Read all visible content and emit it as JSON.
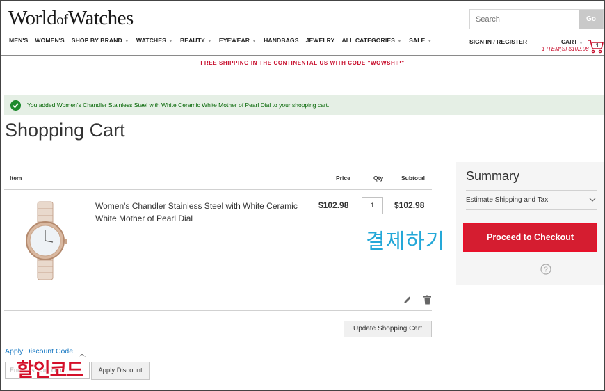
{
  "header": {
    "logo_world": "World",
    "logo_of": "of",
    "logo_watches": "Watches",
    "search_placeholder": "Search",
    "search_button": "Go",
    "nav": [
      {
        "label": "MEN'S",
        "dropdown": false
      },
      {
        "label": "WOMEN'S",
        "dropdown": false
      },
      {
        "label": "SHOP BY BRAND",
        "dropdown": true
      },
      {
        "label": "WATCHES",
        "dropdown": true
      },
      {
        "label": "BEAUTY",
        "dropdown": true
      },
      {
        "label": "EYEWEAR",
        "dropdown": true
      },
      {
        "label": "HANDBAGS",
        "dropdown": false
      },
      {
        "label": "JEWELRY",
        "dropdown": false
      },
      {
        "label": "ALL CATEGORIES",
        "dropdown": true
      },
      {
        "label": "SALE",
        "dropdown": true
      }
    ],
    "signin": "SIGN IN / REGISTER",
    "cart_label": "CART",
    "cart_summary": "1 ITEM(S) $102.98",
    "cart_count": "1"
  },
  "promo": "FREE SHIPPING IN THE CONTINENTAL US WITH CODE \"WOWSHIP\"",
  "success_message": "You added Women's Chandler Stainless Steel with White Ceramic White Mother of Pearl Dial to your shopping cart.",
  "page_title": "Shopping Cart",
  "table": {
    "col_item": "Item",
    "col_price": "Price",
    "col_qty": "Qty",
    "col_subtotal": "Subtotal"
  },
  "cart_item": {
    "name": "Women's Chandler Stainless Steel with White Ceramic White Mother of Pearl Dial",
    "price": "$102.98",
    "qty": "1",
    "subtotal": "$102.98"
  },
  "annotations": {
    "checkout_korean": "결제하기",
    "discount_korean": "할인코드"
  },
  "update_button": "Update Shopping Cart",
  "discount": {
    "label": "Apply Discount Code",
    "input_placeholder": "Enter discount code",
    "apply_button": "Apply Discount"
  },
  "summary": {
    "title": "Summary",
    "estimate": "Estimate Shipping and Tax",
    "checkout_button": "Proceed to Checkout"
  },
  "colors": {
    "brand_red": "#d51d30",
    "link_blue": "#1979c3",
    "success_bg": "#e5efe5",
    "annotation_cyan": "#24a8d8"
  }
}
